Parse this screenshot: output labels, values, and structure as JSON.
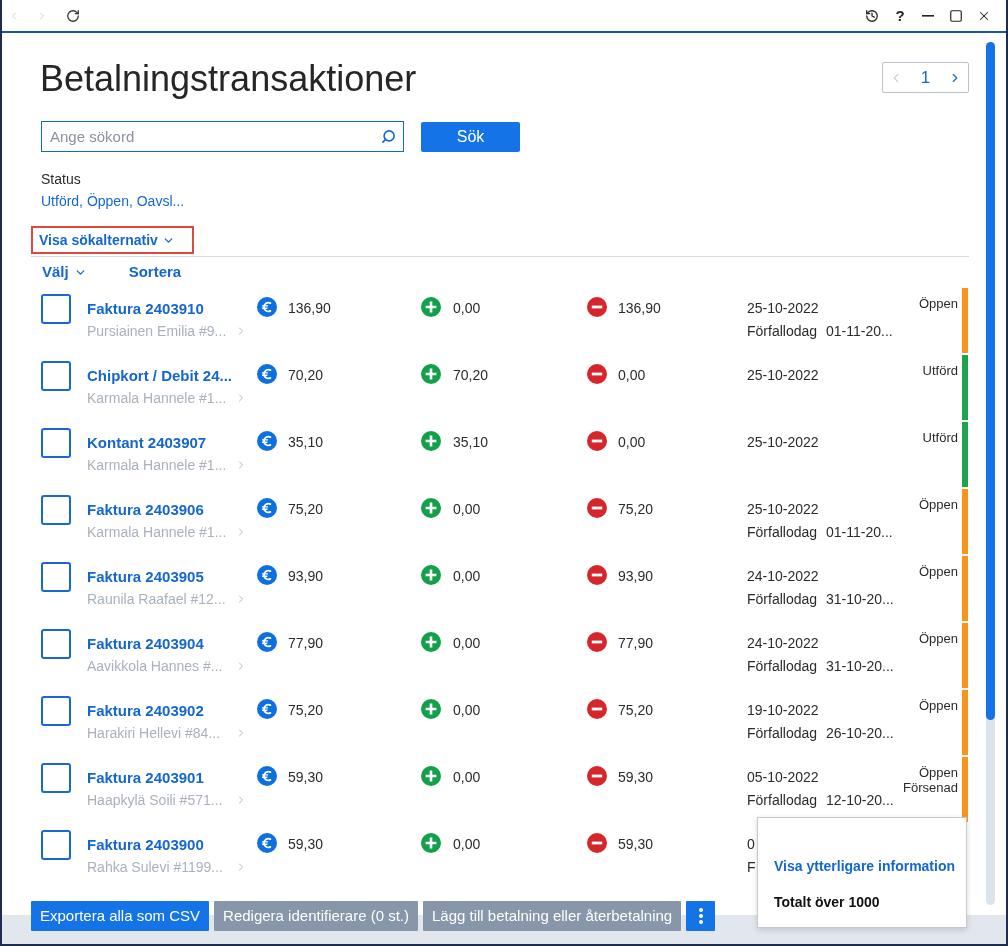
{
  "title_bar": {
    "back_enabled": false,
    "forward_enabled": false,
    "help": "?"
  },
  "page": {
    "title": "Betalningstransaktioner",
    "pager": {
      "prev_enabled": false,
      "page": "1",
      "next_enabled": true
    }
  },
  "search": {
    "placeholder": "Ange sökord",
    "button": "Sök"
  },
  "status_filter": {
    "label": "Status",
    "value": "Utförd, Öppen, Oavsl..."
  },
  "search_options": {
    "label": "Visa sökalternativ",
    "highlighted": true
  },
  "list_header": {
    "select": "Välj",
    "sort": "Sortera"
  },
  "rows": [
    {
      "checked": false,
      "title": "Faktura 2403910",
      "customer": "Pursiainen Emilia #9...",
      "amount": "136,90",
      "paid": "0,00",
      "remaining": "136,90",
      "date": "25-10-2022",
      "due_label": "Förfallodag",
      "due_date": "01-11-20...",
      "status": "Öppen",
      "color": "#f7941d"
    },
    {
      "checked": false,
      "title": "Chipkort / Debit 24...",
      "customer": "Karmala Hannele #1...",
      "amount": "70,20",
      "paid": "70,20",
      "remaining": "0,00",
      "date": "25-10-2022",
      "status": "Utförd",
      "color": "#1ea34a"
    },
    {
      "checked": false,
      "title": "Kontant 2403907",
      "customer": "Karmala Hannele #1...",
      "amount": "35,10",
      "paid": "35,10",
      "remaining": "0,00",
      "date": "25-10-2022",
      "status": "Utförd",
      "color": "#1ea34a"
    },
    {
      "checked": false,
      "title": "Faktura 2403906",
      "customer": "Karmala Hannele #1...",
      "amount": "75,20",
      "paid": "0,00",
      "remaining": "75,20",
      "date": "25-10-2022",
      "due_label": "Förfallodag",
      "due_date": "01-11-20...",
      "status": "Öppen",
      "color": "#f7941d"
    },
    {
      "checked": false,
      "title": "Faktura 2403905",
      "customer": "Raunila Raafael #12...",
      "amount": "93,90",
      "paid": "0,00",
      "remaining": "93,90",
      "date": "24-10-2022",
      "due_label": "Förfallodag",
      "due_date": "31-10-20...",
      "status": "Öppen",
      "color": "#f7941d"
    },
    {
      "checked": false,
      "title": "Faktura 2403904",
      "customer": "Aavikkola Hannes #...",
      "amount": "77,90",
      "paid": "0,00",
      "remaining": "77,90",
      "date": "24-10-2022",
      "due_label": "Förfallodag",
      "due_date": "31-10-20...",
      "status": "Öppen",
      "color": "#f7941d"
    },
    {
      "checked": false,
      "title": "Faktura 2403902",
      "customer": "Harakiri Hellevi #84...",
      "amount": "75,20",
      "paid": "0,00",
      "remaining": "75,20",
      "date": "19-10-2022",
      "due_label": "Förfallodag",
      "due_date": "26-10-20...",
      "status": "Öppen",
      "color": "#f7941d"
    },
    {
      "checked": false,
      "title": "Faktura 2403901",
      "customer": "Haapkylä Soili #571...",
      "amount": "59,30",
      "paid": "0,00",
      "remaining": "59,30",
      "date": "05-10-2022",
      "due_label": "Förfallodag",
      "due_date": "12-10-20...",
      "status": "Öppen",
      "status_note": "Försenad",
      "color": "#f7941d"
    },
    {
      "checked": false,
      "title": "Faktura 2403900",
      "customer": "Rahka Sulevi #1199...",
      "amount": "59,30",
      "paid": "0,00",
      "remaining": "59,30",
      "date": "0",
      "due_label": "F"
    }
  ],
  "footer": {
    "buttons": [
      {
        "label": "Exportera alla som CSV",
        "disabled": false
      },
      {
        "label": "Redigera identifierare (0 st.)",
        "disabled": true
      },
      {
        "label": "Lägg till betalning eller återbetalning",
        "disabled": true
      }
    ]
  },
  "info_popup": {
    "link": "Visa ytterligare information",
    "total": "Totalt över 1000"
  }
}
